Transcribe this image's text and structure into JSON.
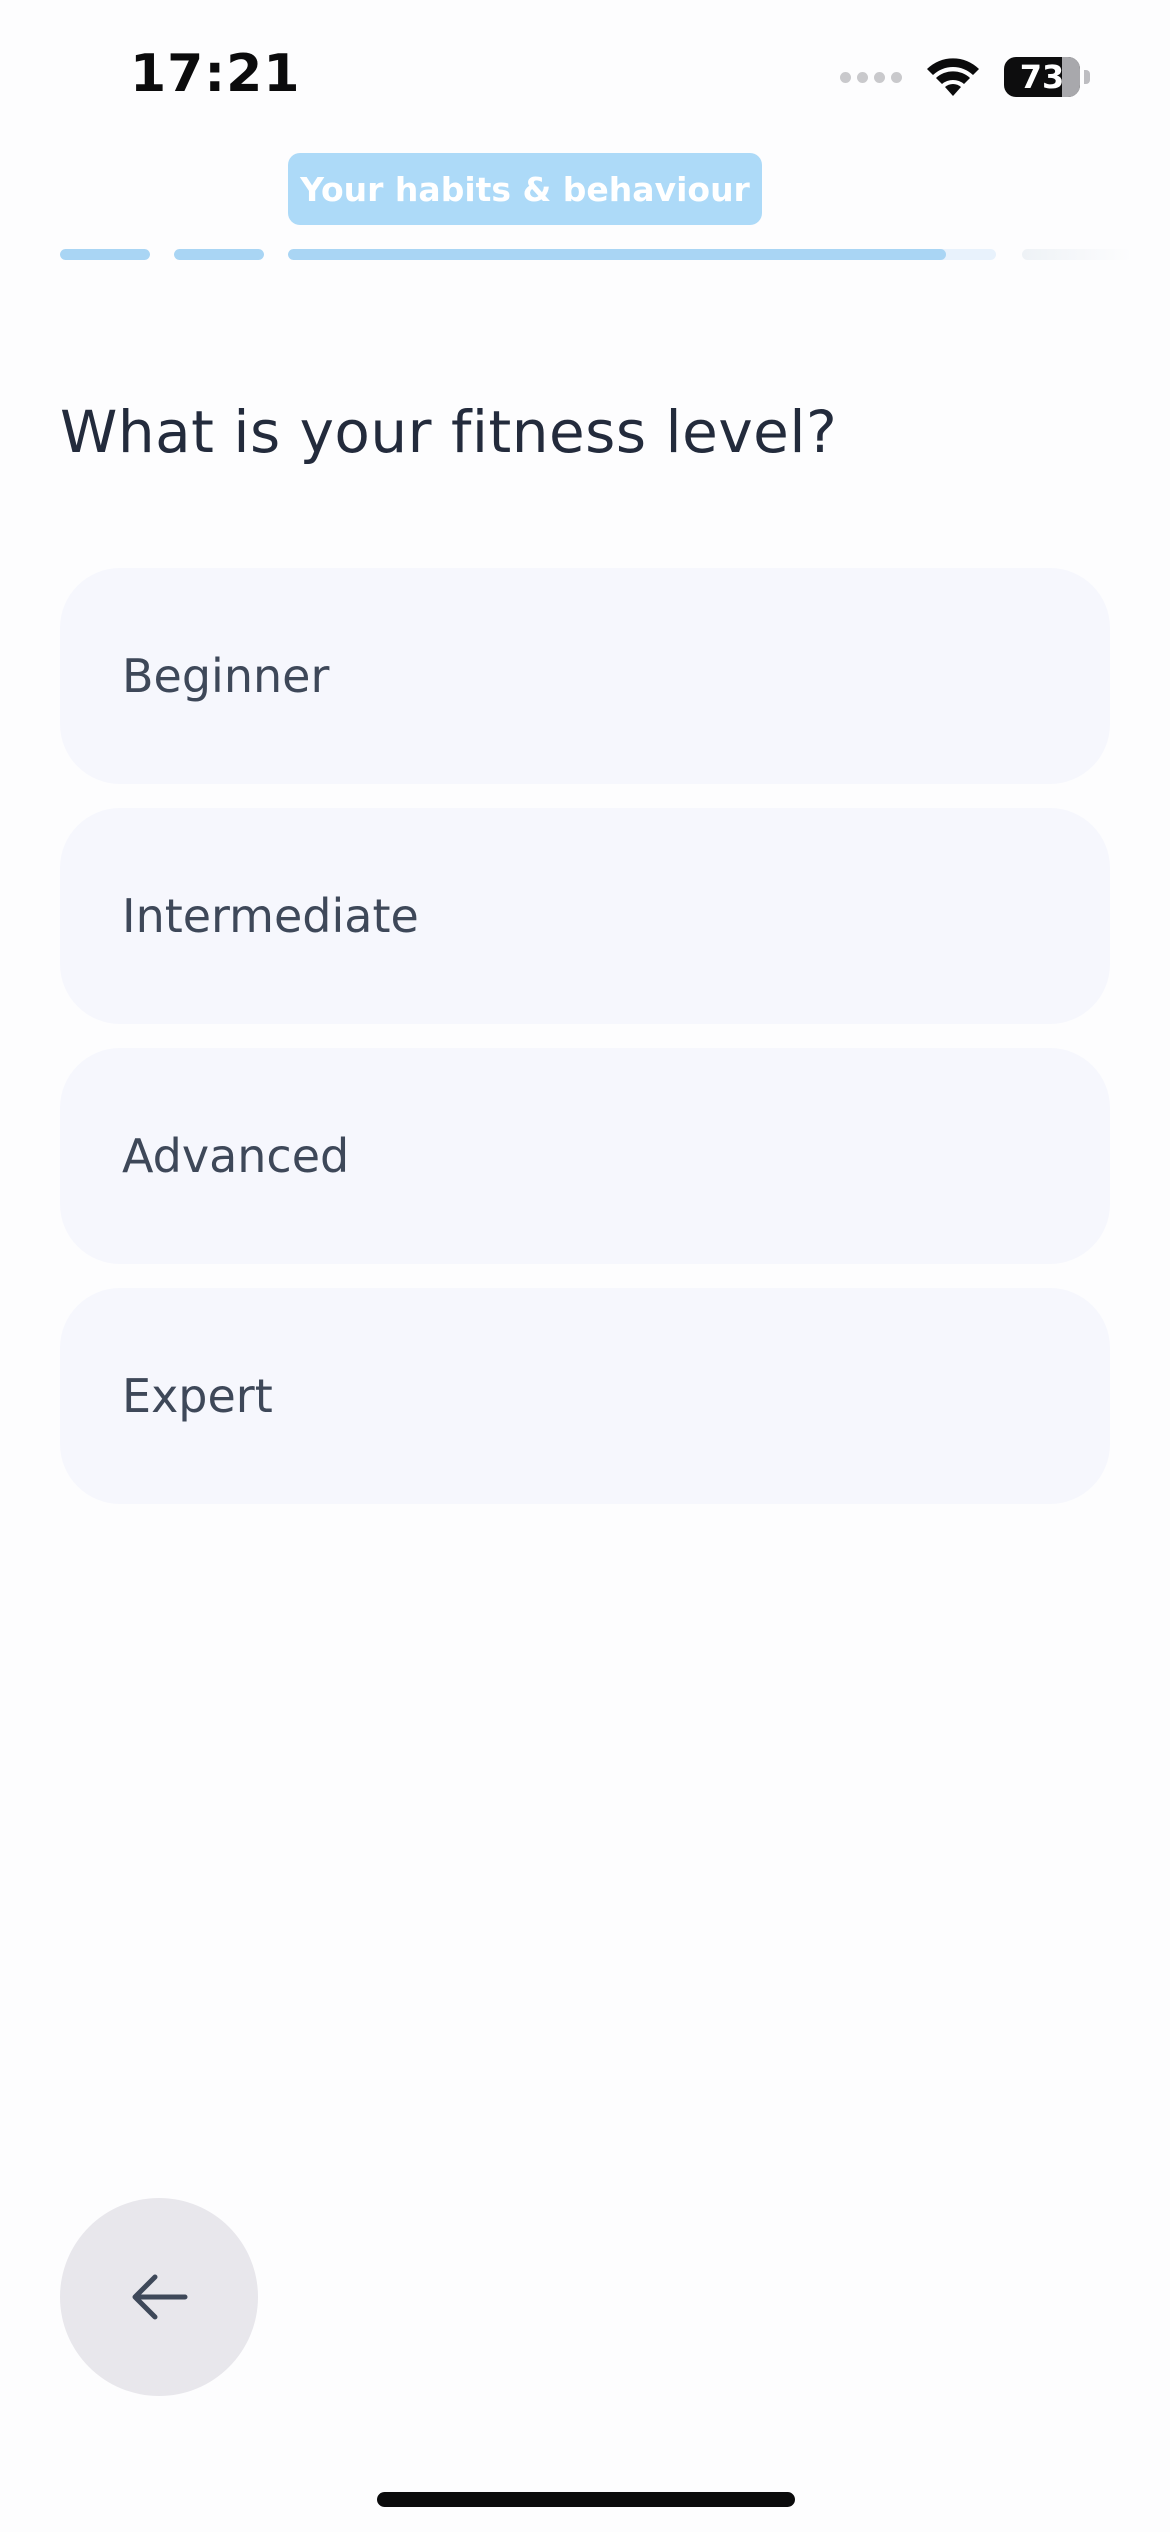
{
  "status_bar": {
    "time": "17:21",
    "battery_level": "73",
    "icons": [
      "signal-dots-icon",
      "wifi-icon",
      "battery-icon"
    ]
  },
  "header": {
    "section_label": "Your habits & behaviour",
    "progress": [
      {
        "segment": 1,
        "fill_fraction": 1.0
      },
      {
        "segment": 2,
        "fill_fraction": 1.0
      },
      {
        "segment": 3,
        "fill_fraction": 0.93
      },
      {
        "segment": 4,
        "fill_fraction": 0.0
      }
    ]
  },
  "question": {
    "text": "What is your fitness level?"
  },
  "options": [
    {
      "label": "Beginner"
    },
    {
      "label": "Intermediate"
    },
    {
      "label": "Advanced"
    },
    {
      "label": "Expert"
    }
  ],
  "navigation": {
    "back_icon": "arrow-left-icon"
  },
  "colors": {
    "accent": "#a9d5f4",
    "pill_background": "#addaf8",
    "option_background": "#f6f7fd",
    "text_primary": "#232b3c",
    "text_option": "#3e4859",
    "back_button_background": "#e8e7ec"
  }
}
